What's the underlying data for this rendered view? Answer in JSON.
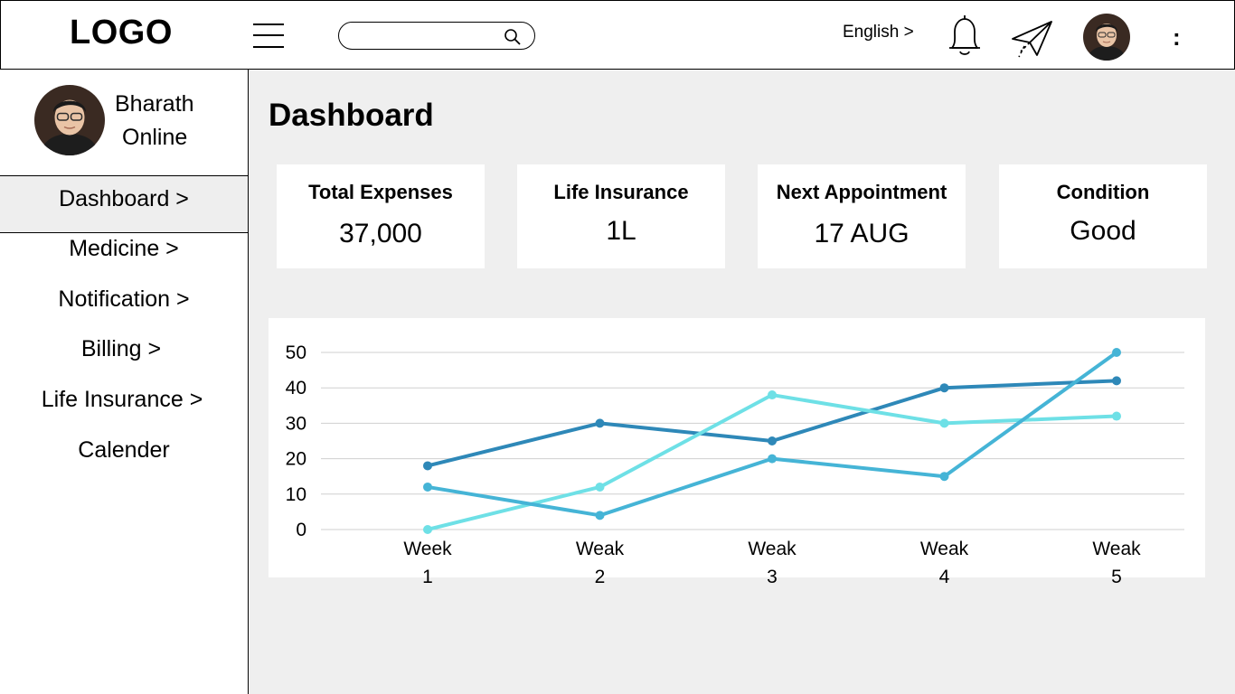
{
  "header": {
    "logo": "LOGO",
    "search": {
      "placeholder": ""
    },
    "language": "English >",
    "more": ":"
  },
  "sidebar": {
    "profile": {
      "name": "Bharath",
      "status": "Online"
    },
    "items": [
      {
        "label": "Dashboard  >",
        "active": true
      },
      {
        "label": "Medicine >"
      },
      {
        "label": "Notification >"
      },
      {
        "label": "Billing >"
      },
      {
        "label": "Life Insurance >"
      },
      {
        "label": "Calender"
      }
    ]
  },
  "main": {
    "title": "Dashboard",
    "cards": [
      {
        "title": "Total Expenses",
        "value": "37,000"
      },
      {
        "title": "Life Insurance",
        "value": "1L"
      },
      {
        "title": "Next Appointment",
        "value": "17 AUG"
      },
      {
        "title": "Condition",
        "value": "Good"
      }
    ]
  },
  "chart_data": {
    "type": "line",
    "categories": [
      [
        "Week",
        "1"
      ],
      [
        "Weak",
        "2"
      ],
      [
        "Weak",
        "3"
      ],
      [
        "Weak",
        "4"
      ],
      [
        "Weak",
        "5"
      ]
    ],
    "yticks": [
      0,
      10,
      20,
      30,
      40,
      50
    ],
    "ylim": [
      0,
      50
    ],
    "grid": true,
    "series": [
      {
        "color": "#2e88b8",
        "values": [
          18,
          30,
          25,
          40,
          42
        ]
      },
      {
        "color": "#6ee0e6",
        "values": [
          0,
          12,
          38,
          30,
          32
        ]
      },
      {
        "color": "#45b4d6",
        "values": [
          12,
          4,
          20,
          15,
          50
        ]
      }
    ]
  }
}
